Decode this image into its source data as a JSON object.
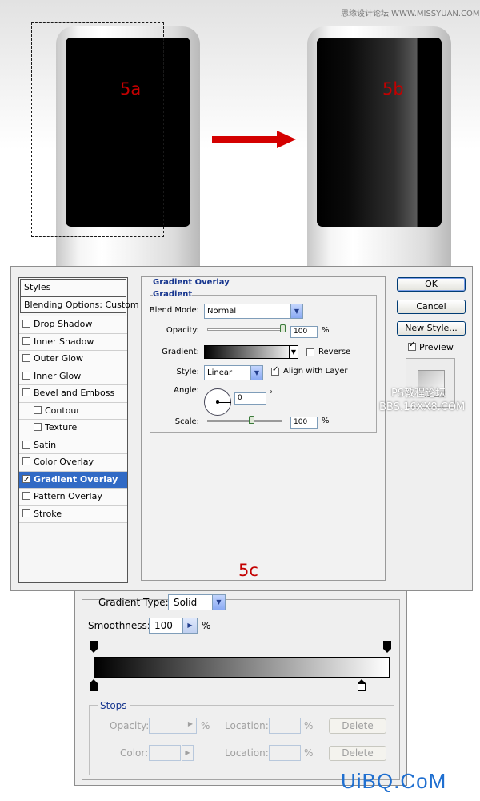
{
  "watermarks": {
    "site_top": "思缘设计论坛 WWW.MISSYUAN.COM",
    "forum_line1": "PS教程论坛",
    "forum_line2": "BBS.16XX8.COM",
    "bottom_logo": "UiBQ.CoM"
  },
  "labels": {
    "step_a": "5a",
    "step_b": "5b",
    "step_c": "5c"
  },
  "colors": {
    "label_red": "#c40000",
    "arrow_red": "#d40000",
    "selection_blue": "#316ac5",
    "group_title_blue": "#17368f"
  },
  "layer_style": {
    "styles_header": "Styles",
    "blending_options": "Blending Options: Custom",
    "items": [
      {
        "label": "Drop Shadow",
        "checked": false
      },
      {
        "label": "Inner Shadow",
        "checked": false
      },
      {
        "label": "Outer Glow",
        "checked": false
      },
      {
        "label": "Inner Glow",
        "checked": false
      },
      {
        "label": "Bevel and Emboss",
        "checked": false
      },
      {
        "label": "Contour",
        "checked": false
      },
      {
        "label": "Texture",
        "checked": false
      },
      {
        "label": "Satin",
        "checked": false
      },
      {
        "label": "Color Overlay",
        "checked": false
      },
      {
        "label": "Gradient Overlay",
        "checked": true
      },
      {
        "label": "Pattern Overlay",
        "checked": false
      },
      {
        "label": "Stroke",
        "checked": false
      }
    ],
    "panel_title": "Gradient Overlay",
    "group_title": "Gradient",
    "blend_mode_label": "Blend Mode:",
    "blend_mode_value": "Normal",
    "opacity_label": "Opacity:",
    "opacity_value": "100",
    "opacity_level": 1.0,
    "percent": "%",
    "gradient_label": "Gradient:",
    "reverse_label": "Reverse",
    "reverse_checked": false,
    "style_label": "Style:",
    "style_value": "Linear",
    "align_label": "Align with Layer",
    "align_checked": true,
    "angle_label": "Angle:",
    "angle_value": "0",
    "degree": "°",
    "scale_label": "Scale:",
    "scale_value": "100",
    "scale_level": 0.6,
    "ok_label": "OK",
    "cancel_label": "Cancel",
    "new_style_label": "New Style...",
    "preview_label": "Preview",
    "preview_checked": true
  },
  "gradient_editor": {
    "type_label": "Gradient Type:",
    "type_value": "Solid",
    "smoothness_label": "Smoothness:",
    "smoothness_value": "100",
    "percent": "%",
    "stops_title": "Stops",
    "opacity_label": "Opacity:",
    "color_label": "Color:",
    "location_label": "Location:",
    "delete_label": "Delete"
  }
}
